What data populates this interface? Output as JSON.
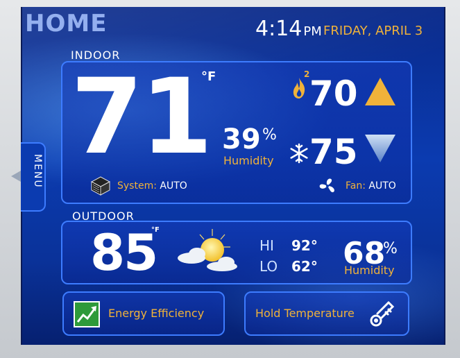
{
  "header": {
    "title": "HOME",
    "time": "4:14",
    "ampm": "PM",
    "date": "FRIDAY, APRIL 3"
  },
  "indoor": {
    "label": "INDOOR",
    "temperature": "71",
    "unit": "°F",
    "humidity": "39",
    "humidity_unit": "%",
    "humidity_label": "Humidity",
    "heat_stage": "2",
    "heat_setpoint": "70",
    "cool_setpoint": "75",
    "system_label": "System:",
    "system_value": "AUTO",
    "fan_label": "Fan:",
    "fan_value": "AUTO"
  },
  "outdoor": {
    "label": "OUTDOOR",
    "temperature": "85",
    "unit": "°F",
    "hi_label": "HI",
    "hi_value": "92°",
    "lo_label": "LO",
    "lo_value": "62°",
    "humidity": "68",
    "humidity_unit": "%",
    "humidity_label": "Humidity",
    "weather_icon": "partly-sunny-icon"
  },
  "buttons": {
    "energy": "Energy Efficiency",
    "hold": "Hold Temperature"
  },
  "menu": {
    "label": "MENU"
  },
  "colors": {
    "accent": "#f0b23a",
    "panel_border": "#3d7cff",
    "background": "#0b3bb0"
  }
}
